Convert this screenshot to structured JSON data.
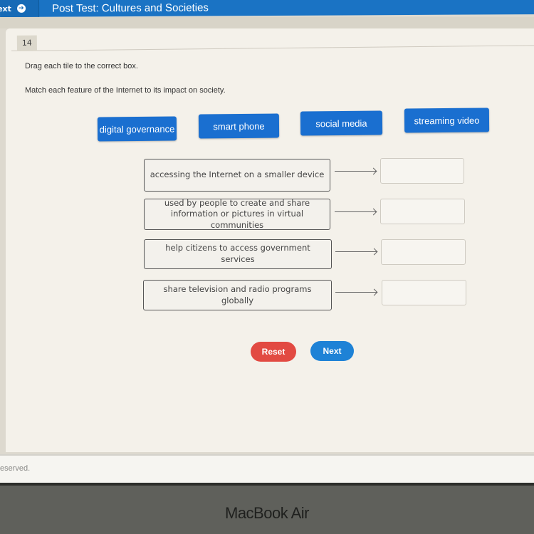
{
  "header": {
    "nav_next_label": "ext",
    "nav_next_icon": "arrow-circle-right-icon",
    "title": "Post Test: Cultures and Societies",
    "bar_color": "#1a73c4"
  },
  "question": {
    "number": "14",
    "instruction_1": "Drag each tile to the correct box.",
    "instruction_2": "Match each feature of the Internet to its impact on society."
  },
  "tiles": [
    {
      "label": "digital governance"
    },
    {
      "label": "smart phone"
    },
    {
      "label": "social media"
    },
    {
      "label": "streaming video"
    }
  ],
  "tile_color": "#1a6fd0",
  "pairs": [
    {
      "prompt": "accessing the Internet on a smaller device",
      "answer": ""
    },
    {
      "prompt": "used by people to create and share information or pictures in virtual communities",
      "answer": ""
    },
    {
      "prompt": "help citizens to access government services",
      "answer": ""
    },
    {
      "prompt": "share television and radio programs globally",
      "answer": ""
    }
  ],
  "buttons": {
    "reset_label": "Reset",
    "next_label": "Next",
    "reset_color": "#e24a42",
    "next_color": "#1e82d6"
  },
  "footer": {
    "text": "eserved."
  },
  "device": {
    "bezel_label": "MacBook Air"
  }
}
